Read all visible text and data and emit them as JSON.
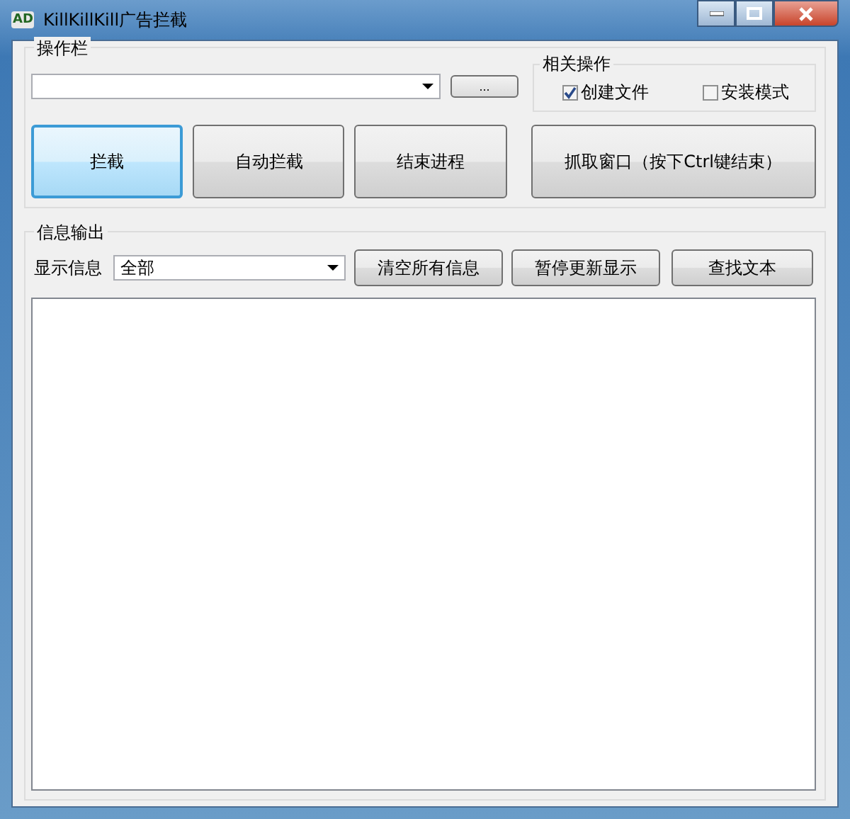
{
  "window": {
    "title": "KillKillKill广告拦截",
    "icon_text": "AD"
  },
  "toolbar_group": {
    "title": "操作栏",
    "browse_button": "...",
    "related": {
      "title": "相关操作",
      "checkboxes": [
        {
          "label": "创建文件",
          "checked": true
        },
        {
          "label": "安装模式",
          "checked": false
        }
      ]
    },
    "buttons": [
      {
        "label": "拦截",
        "selected": true
      },
      {
        "label": "自动拦截",
        "selected": false
      },
      {
        "label": "结束进程",
        "selected": false
      },
      {
        "label": "抓取窗口（按下Ctrl键结束）",
        "selected": false
      }
    ]
  },
  "output_group": {
    "title": "信息输出",
    "filter_label": "显示信息",
    "filter_value": "全部",
    "buttons": [
      "清空所有信息",
      "暂停更新显示",
      "查找文本"
    ]
  }
}
